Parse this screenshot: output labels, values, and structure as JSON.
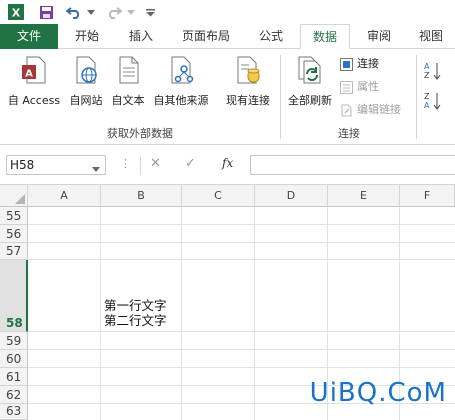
{
  "tabs": [
    "文件",
    "开始",
    "插入",
    "页面布局",
    "公式",
    "数据",
    "审阅",
    "视图"
  ],
  "active_tab": "数据",
  "ribbon": {
    "get_external": {
      "buttons": [
        "自 Access",
        "自网站",
        "自文本",
        "自其他来源",
        "现有连接"
      ],
      "group_label": "获取外部数据"
    },
    "connections": {
      "refresh_all": "全部刷新",
      "connections": "连接",
      "properties": "属性",
      "edit_links": "编辑链接",
      "group_label": "连接"
    }
  },
  "formula_bar": {
    "name_box": "H58",
    "cancel": "✕",
    "enter": "✓",
    "fx": "fx",
    "value": ""
  },
  "columns": [
    "A",
    "B",
    "C",
    "D",
    "E",
    "F"
  ],
  "rows": [
    "55",
    "56",
    "57",
    "58",
    "59",
    "60",
    "61",
    "62",
    "63"
  ],
  "selected_row": "58",
  "cell_b58": {
    "line1": "第一行文字",
    "line2": "第二行文字"
  },
  "watermark": "UiBQ.CoM",
  "colors": {
    "excel_green": "#217346",
    "watermark_blue": "#1a73c8"
  }
}
